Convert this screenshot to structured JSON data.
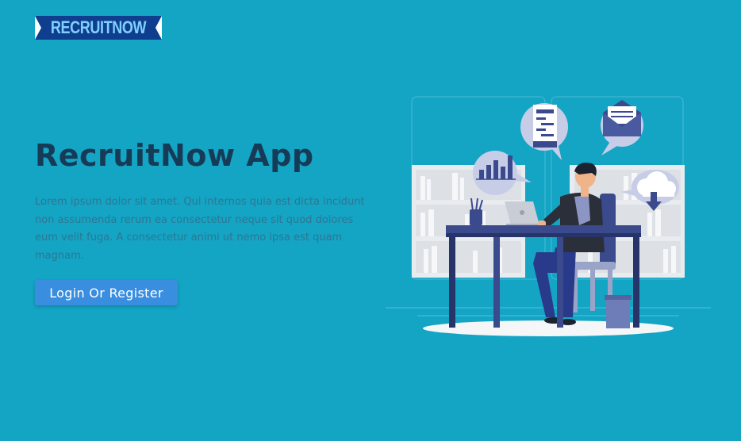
{
  "brand": {
    "logo_text": "RECRUITNOW"
  },
  "hero": {
    "title": "RecruitNow App",
    "description": "Lorem ipsum dolor sit amet. Qui internos quia est dicta incidunt non assumenda rerum ea consectetur neque sit quod dolores eum velit fuga. A consectetur animi ut nemo ipsa est quam magnam.",
    "cta_label": "Login Or Register"
  },
  "illustration": {
    "icons": [
      "chat-bubble-icon",
      "envelope-icon",
      "bar-chart-icon",
      "cloud-download-icon",
      "laptop-icon",
      "pencil-cup-icon",
      "trash-bin-icon"
    ]
  },
  "colors": {
    "background": "#14a4c4",
    "title": "#163b57",
    "button": "#3a8ee0",
    "logo_bg": "#0f3e8e"
  }
}
